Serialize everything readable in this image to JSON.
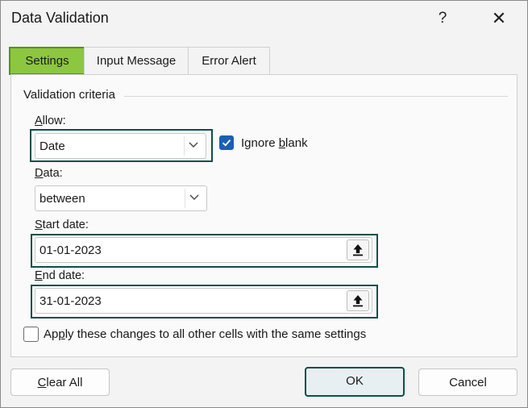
{
  "window": {
    "title": "Data Validation",
    "help_glyph": "?",
    "close_glyph": "✕"
  },
  "tabs": [
    {
      "label": "Settings",
      "active": true
    },
    {
      "label": "Input Message",
      "active": false
    },
    {
      "label": "Error Alert",
      "active": false
    }
  ],
  "settings": {
    "group_title": "Validation criteria",
    "allow": {
      "label_u": "A",
      "label_rest": "llow:",
      "value": "Date"
    },
    "ignore_blank": {
      "label_pre": "Ignore ",
      "label_u": "b",
      "label_post": "lank",
      "checked": true
    },
    "data": {
      "label_u": "D",
      "label_rest": "ata:",
      "value": "between"
    },
    "start_date": {
      "label_u": "S",
      "label_rest": "tart date:",
      "value": "01-01-2023"
    },
    "end_date": {
      "label_u": "E",
      "label_rest": "nd date:",
      "value": "31-01-2023"
    },
    "apply_all": {
      "label_pre": "Ap",
      "label_u": "p",
      "label_post": "ly these changes to all other cells with the same settings",
      "checked": false
    }
  },
  "buttons": {
    "clear_all_u": "C",
    "clear_all_rest": "lear All",
    "ok": "OK",
    "cancel": "Cancel"
  },
  "colors": {
    "active_tab": "#8dc63f",
    "highlight_border": "#0e4f4a",
    "checkbox": "#1a5fb4"
  }
}
